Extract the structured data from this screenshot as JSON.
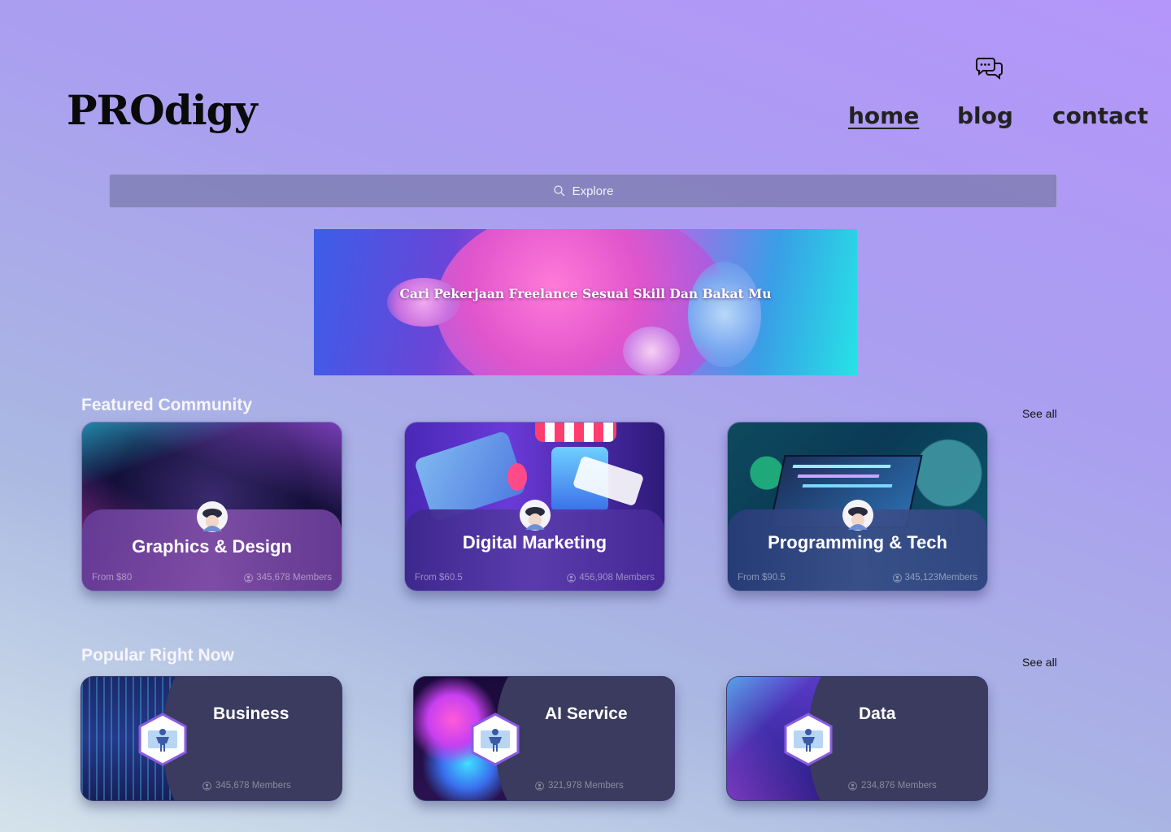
{
  "header": {
    "logo": "PROdigy",
    "nav": {
      "home": "home",
      "blog": "blog",
      "contact": "contact"
    }
  },
  "search": {
    "placeholder": "Explore"
  },
  "banner": {
    "text": "Cari Pekerjaan Freelance Sesuai Skill Dan Bakat Mu"
  },
  "featured": {
    "title": "Featured Community",
    "see_all": "See all",
    "cards": [
      {
        "title": "Graphics & Design",
        "price": "From $80",
        "members": "345,678 Members"
      },
      {
        "title": "Digital Marketing",
        "price": "From $60.5",
        "members": "456,908 Members"
      },
      {
        "title": "Programming & Tech",
        "price": "From $90.5",
        "members": "345,123Members"
      }
    ]
  },
  "popular": {
    "title": "Popular Right Now",
    "see_all": "See all",
    "cards": [
      {
        "title": "Business",
        "members": "345,678 Members"
      },
      {
        "title": "AI Service",
        "members": "321,978 Members"
      },
      {
        "title": "Data",
        "members": "234,876 Members"
      }
    ]
  },
  "icons": {
    "chat": "chat-bubbles-icon",
    "search": "search-icon",
    "user": "user-icon",
    "badge": "vr-avatar-icon"
  }
}
